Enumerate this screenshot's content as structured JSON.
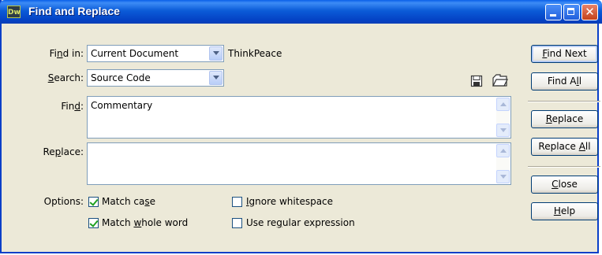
{
  "window": {
    "title": "Find and Replace",
    "app_icon_text": "Dw"
  },
  "find_in": {
    "label_pre": "Fi",
    "label_key": "n",
    "label_post": "d in:",
    "value": "Current Document",
    "doc_name": "ThinkPeace"
  },
  "search": {
    "label_pre": "",
    "label_key": "S",
    "label_post": "earch:",
    "value": "Source Code"
  },
  "find": {
    "label_pre": "Fin",
    "label_key": "d",
    "label_post": ":",
    "value": "Commentary"
  },
  "replace": {
    "label_pre": "Re",
    "label_key": "p",
    "label_post": "lace:",
    "value": ""
  },
  "options": {
    "label": "Options:",
    "match_case": {
      "pre": "Match ca",
      "key": "s",
      "post": "e",
      "checked": true
    },
    "match_whole_word": {
      "pre": "Match ",
      "key": "w",
      "post": "hole word",
      "checked": true
    },
    "ignore_whitespace": {
      "pre": "",
      "key": "I",
      "post": "gnore whitespace",
      "checked": false
    },
    "use_regex": {
      "pre": "Use re",
      "key": "g",
      "post": "ular expression",
      "checked": false
    }
  },
  "buttons": {
    "find_next": {
      "pre": "",
      "key": "F",
      "post": "ind Next"
    },
    "find_all": {
      "pre": "Find A",
      "key": "l",
      "post": "l"
    },
    "replace": {
      "pre": "",
      "key": "R",
      "post": "eplace"
    },
    "replace_all": {
      "pre": "Replace ",
      "key": "A",
      "post": "ll"
    },
    "close": {
      "pre": "",
      "key": "C",
      "post": "lose"
    },
    "help": {
      "pre": "",
      "key": "H",
      "post": "elp"
    }
  },
  "icons": {
    "save": "save-query-icon",
    "load": "load-query-icon"
  },
  "colors": {
    "titlebar": "#0a5fe8",
    "dialog_bg": "#ece9d8",
    "check": "#21a121"
  }
}
